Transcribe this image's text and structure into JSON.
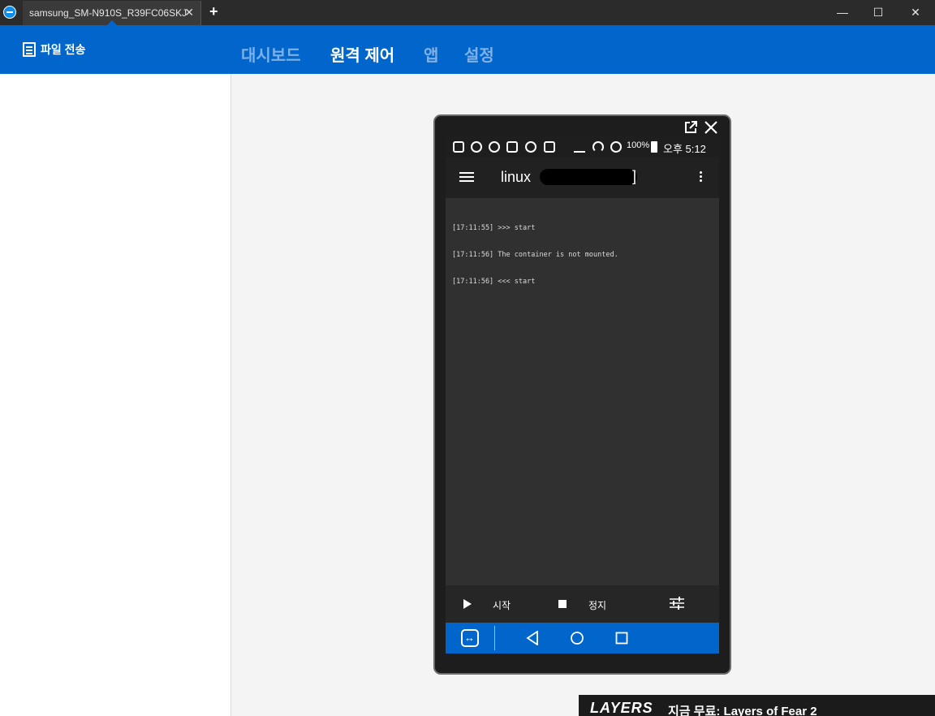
{
  "window": {
    "tab_title": "samsung_SM-N910S_R39FC06SKJ",
    "tab_close": "✕",
    "new_tab": "+",
    "minimize": "—",
    "maximize": "☐",
    "close": "✕"
  },
  "header": {
    "file_transfer": "파일 전송",
    "nav": [
      "대시보드",
      "원격 제어",
      "앱",
      "설정"
    ],
    "active_nav": "원격 제어"
  },
  "phone": {
    "status_bar": {
      "battery": "100%",
      "time": "오후 5:12"
    },
    "toolbar": {
      "title": "linux",
      "bracket_open": "[",
      "bracket_close": "]"
    },
    "log_lines": [
      "[17:11:55] >>> start",
      "[17:11:56] The container is not mounted.",
      "[17:11:56] <<< start"
    ],
    "bottom_bar": {
      "start_label": "시작",
      "stop_label": "정지"
    }
  },
  "ad": {
    "logo": "LAYERS",
    "text": "지금 무료: Layers of Fear 2"
  },
  "colors": {
    "titlebar": "#2b2b2b",
    "brand_blue": "#0066cc",
    "nav_inactive": "#7fb0e6",
    "screen_bg": "#303030"
  }
}
